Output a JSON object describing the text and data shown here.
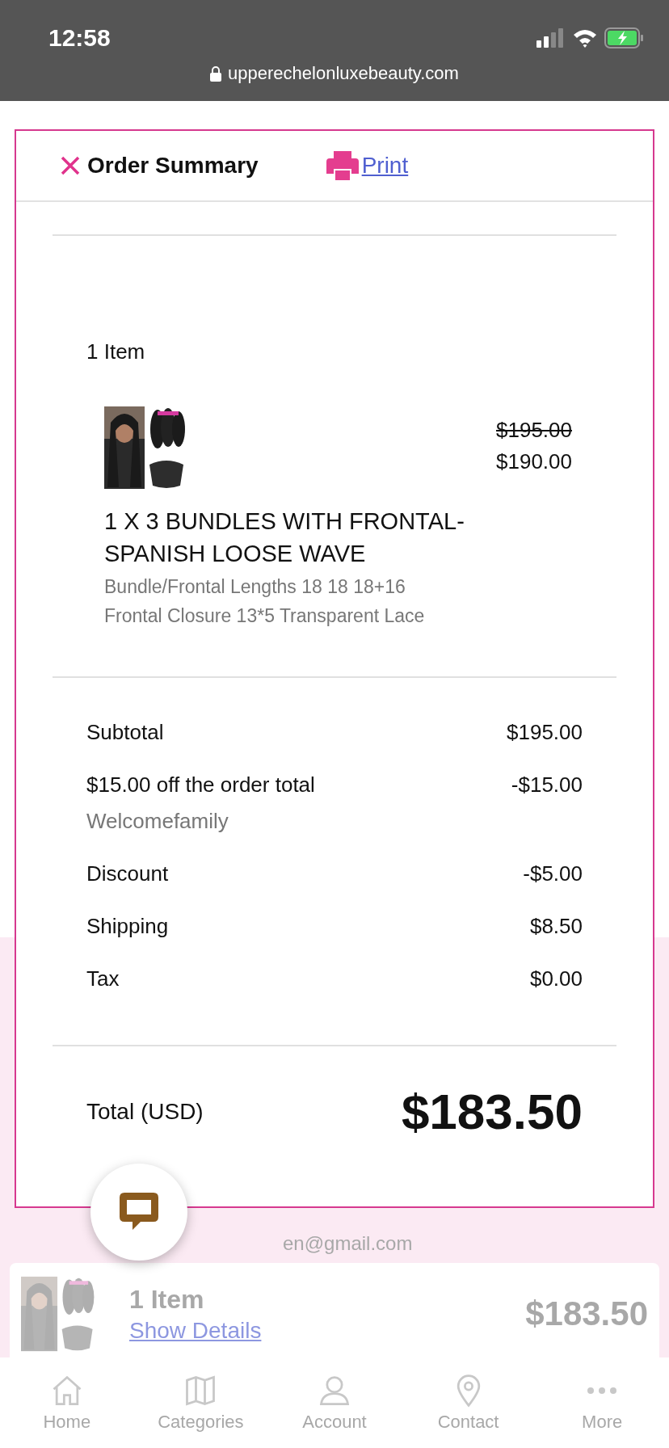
{
  "status_bar": {
    "time": "12:58",
    "url": "upperechelonluxebeauty.com"
  },
  "modal": {
    "title": "Order Summary",
    "print_link": "Print"
  },
  "order": {
    "item_count": "1 Item",
    "items": [
      {
        "original_price": "$195.00",
        "price": "$190.00",
        "name": "1 X 3 BUNDLES WITH FRONTAL-SPANISH LOOSE WAVE",
        "options": [
          "Bundle/Frontal Lengths 18 18 18+16",
          "Frontal Closure 13*5 Transparent Lace"
        ]
      }
    ]
  },
  "totals": [
    {
      "label": "Subtotal",
      "value": "$195.00"
    },
    {
      "label": "$15.00 off the order total",
      "note": "Welcomefamily",
      "value": "-$15.00"
    },
    {
      "label": "Discount",
      "value": "-$5.00"
    },
    {
      "label": "Shipping",
      "value": "$8.50"
    },
    {
      "label": "Tax",
      "value": "$0.00"
    }
  ],
  "total": {
    "label": "Total (USD)",
    "value": "$183.50"
  },
  "background": {
    "email": "en@gmail.com",
    "cart_bar": {
      "count": "1 Item",
      "link": "Show Details",
      "total": "$183.50"
    }
  },
  "tab_bar": [
    {
      "label": "Home",
      "kind": "home"
    },
    {
      "label": "Categories",
      "kind": "map"
    },
    {
      "label": "Account",
      "kind": "person"
    },
    {
      "label": "Contact",
      "kind": "pin"
    },
    {
      "label": "More",
      "kind": "dots"
    }
  ]
}
